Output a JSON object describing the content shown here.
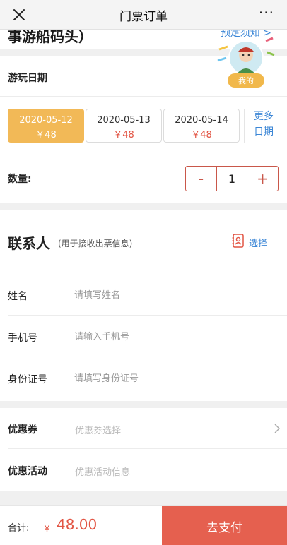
{
  "nav": {
    "title": "门票订单",
    "more": "···"
  },
  "header": {
    "venue_name": "事游船码头）",
    "notice_link": "预定须知 >"
  },
  "floating": {
    "mine_label": "我的"
  },
  "date_section": {
    "title": "游玩日期",
    "options": [
      {
        "date": "2020-05-12",
        "price": "￥48",
        "selected": true
      },
      {
        "date": "2020-05-13",
        "price": "￥48",
        "selected": false
      },
      {
        "date": "2020-05-14",
        "price": "￥48",
        "selected": false
      }
    ],
    "more_line1": "更多",
    "more_line2": "日期"
  },
  "quantity": {
    "label": "数量:",
    "minus": "-",
    "value": "1",
    "plus": "+"
  },
  "contact": {
    "title": "联系人",
    "hint": "(用于接收出票信息)",
    "choose_label": "选择",
    "fields": [
      {
        "label": "姓名",
        "placeholder": "请填写姓名"
      },
      {
        "label": "手机号",
        "placeholder": "请输入手机号"
      },
      {
        "label": "身份证号",
        "placeholder": "请填写身份证号"
      }
    ]
  },
  "promo": {
    "coupon_label": "优惠券",
    "coupon_value": "优惠券选择",
    "activity_label": "优惠活动",
    "activity_value": "优惠活动信息"
  },
  "footer": {
    "total_label": "合计:",
    "currency": "￥",
    "amount": "48.00",
    "pay_label": "去支付"
  },
  "colors": {
    "accent_red": "#e5604f",
    "selected_date": "#f2b957",
    "link_blue": "#3b86d6"
  }
}
